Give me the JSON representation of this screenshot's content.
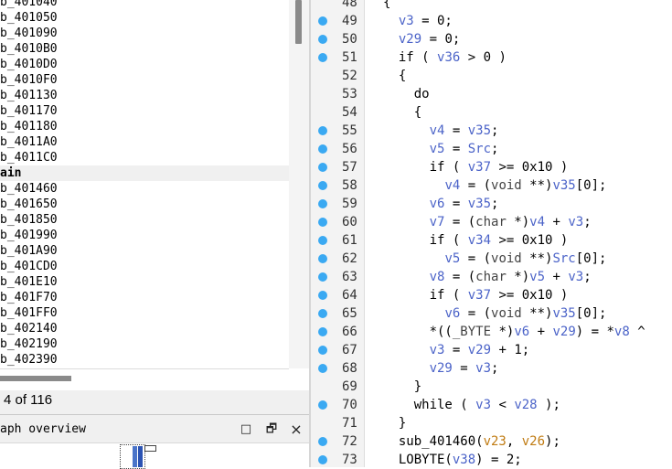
{
  "functions_panel": {
    "items": [
      {
        "label": "b_401040",
        "bold": false
      },
      {
        "label": "b_401050",
        "bold": false
      },
      {
        "label": "b_401090",
        "bold": false
      },
      {
        "label": "b_4010B0",
        "bold": false
      },
      {
        "label": "b_4010D0",
        "bold": false
      },
      {
        "label": "b_4010F0",
        "bold": false
      },
      {
        "label": "b_401130",
        "bold": false
      },
      {
        "label": "b_401170",
        "bold": false
      },
      {
        "label": "b_401180",
        "bold": false
      },
      {
        "label": "b_4011A0",
        "bold": false
      },
      {
        "label": "b_4011C0",
        "bold": false
      },
      {
        "label": "ain",
        "bold": true
      },
      {
        "label": "b_401460",
        "bold": false
      },
      {
        "label": "b_401650",
        "bold": false
      },
      {
        "label": "b_401850",
        "bold": false
      },
      {
        "label": "b_401990",
        "bold": false
      },
      {
        "label": "b_401A90",
        "bold": false
      },
      {
        "label": "b_401CD0",
        "bold": false
      },
      {
        "label": "b_401E10",
        "bold": false
      },
      {
        "label": "b_401F70",
        "bold": false
      },
      {
        "label": "b_401FF0",
        "bold": false
      },
      {
        "label": "b_402140",
        "bold": false
      },
      {
        "label": "b_402190",
        "bold": false
      },
      {
        "label": "b_402390",
        "bold": false
      }
    ],
    "count_text": "4 of 116"
  },
  "graph_overview": {
    "title": "aph overview",
    "maximize_icon": "□",
    "restore_icon": "🗗",
    "close_icon": "×"
  },
  "code_view": {
    "lines": [
      {
        "num": "48",
        "bp": false,
        "tokens": [
          {
            "t": "{",
            "c": "k"
          }
        ]
      },
      {
        "num": "49",
        "bp": true,
        "tokens": [
          {
            "t": "  ",
            "c": "k"
          },
          {
            "t": "v3",
            "c": "v"
          },
          {
            "t": " = 0;",
            "c": "k"
          }
        ]
      },
      {
        "num": "50",
        "bp": true,
        "tokens": [
          {
            "t": "  ",
            "c": "k"
          },
          {
            "t": "v29",
            "c": "v"
          },
          {
            "t": " = 0;",
            "c": "k"
          }
        ]
      },
      {
        "num": "51",
        "bp": true,
        "tokens": [
          {
            "t": "  if ( ",
            "c": "k"
          },
          {
            "t": "v36",
            "c": "v"
          },
          {
            "t": " > 0 )",
            "c": "k"
          }
        ]
      },
      {
        "num": "52",
        "bp": false,
        "tokens": [
          {
            "t": "  {",
            "c": "k"
          }
        ]
      },
      {
        "num": "53",
        "bp": false,
        "tokens": [
          {
            "t": "    do",
            "c": "k"
          }
        ]
      },
      {
        "num": "54",
        "bp": false,
        "tokens": [
          {
            "t": "    {",
            "c": "k"
          }
        ]
      },
      {
        "num": "55",
        "bp": true,
        "tokens": [
          {
            "t": "      ",
            "c": "k"
          },
          {
            "t": "v4",
            "c": "v"
          },
          {
            "t": " = ",
            "c": "k"
          },
          {
            "t": "v35",
            "c": "v"
          },
          {
            "t": ";",
            "c": "k"
          }
        ]
      },
      {
        "num": "56",
        "bp": true,
        "tokens": [
          {
            "t": "      ",
            "c": "k"
          },
          {
            "t": "v5",
            "c": "v"
          },
          {
            "t": " = ",
            "c": "k"
          },
          {
            "t": "Src",
            "c": "v"
          },
          {
            "t": ";",
            "c": "k"
          }
        ]
      },
      {
        "num": "57",
        "bp": true,
        "tokens": [
          {
            "t": "      if ( ",
            "c": "k"
          },
          {
            "t": "v37",
            "c": "v"
          },
          {
            "t": " >= 0x10 )",
            "c": "k"
          }
        ]
      },
      {
        "num": "58",
        "bp": true,
        "tokens": [
          {
            "t": "        ",
            "c": "k"
          },
          {
            "t": "v4",
            "c": "v"
          },
          {
            "t": " = (",
            "c": "k"
          },
          {
            "t": "void",
            "c": "g"
          },
          {
            "t": " **)",
            "c": "k"
          },
          {
            "t": "v35",
            "c": "v"
          },
          {
            "t": "[0];",
            "c": "k"
          }
        ]
      },
      {
        "num": "59",
        "bp": true,
        "tokens": [
          {
            "t": "      ",
            "c": "k"
          },
          {
            "t": "v6",
            "c": "v"
          },
          {
            "t": " = ",
            "c": "k"
          },
          {
            "t": "v35",
            "c": "v"
          },
          {
            "t": ";",
            "c": "k"
          }
        ]
      },
      {
        "num": "60",
        "bp": true,
        "tokens": [
          {
            "t": "      ",
            "c": "k"
          },
          {
            "t": "v7",
            "c": "v"
          },
          {
            "t": " = (",
            "c": "k"
          },
          {
            "t": "char",
            "c": "g"
          },
          {
            "t": " *)",
            "c": "k"
          },
          {
            "t": "v4",
            "c": "v"
          },
          {
            "t": " + ",
            "c": "k"
          },
          {
            "t": "v3",
            "c": "v"
          },
          {
            "t": ";",
            "c": "k"
          }
        ]
      },
      {
        "num": "61",
        "bp": true,
        "tokens": [
          {
            "t": "      if ( ",
            "c": "k"
          },
          {
            "t": "v34",
            "c": "v"
          },
          {
            "t": " >= 0x10 )",
            "c": "k"
          }
        ]
      },
      {
        "num": "62",
        "bp": true,
        "tokens": [
          {
            "t": "        ",
            "c": "k"
          },
          {
            "t": "v5",
            "c": "v"
          },
          {
            "t": " = (",
            "c": "k"
          },
          {
            "t": "void",
            "c": "g"
          },
          {
            "t": " **)",
            "c": "k"
          },
          {
            "t": "Src",
            "c": "v"
          },
          {
            "t": "[0];",
            "c": "k"
          }
        ]
      },
      {
        "num": "63",
        "bp": true,
        "tokens": [
          {
            "t": "      ",
            "c": "k"
          },
          {
            "t": "v8",
            "c": "v"
          },
          {
            "t": " = (",
            "c": "k"
          },
          {
            "t": "char",
            "c": "g"
          },
          {
            "t": " *)",
            "c": "k"
          },
          {
            "t": "v5",
            "c": "v"
          },
          {
            "t": " + ",
            "c": "k"
          },
          {
            "t": "v3",
            "c": "v"
          },
          {
            "t": ";",
            "c": "k"
          }
        ]
      },
      {
        "num": "64",
        "bp": true,
        "tokens": [
          {
            "t": "      if ( ",
            "c": "k"
          },
          {
            "t": "v37",
            "c": "v"
          },
          {
            "t": " >= 0x10 )",
            "c": "k"
          }
        ]
      },
      {
        "num": "65",
        "bp": true,
        "tokens": [
          {
            "t": "        ",
            "c": "k"
          },
          {
            "t": "v6",
            "c": "v"
          },
          {
            "t": " = (",
            "c": "k"
          },
          {
            "t": "void",
            "c": "g"
          },
          {
            "t": " **)",
            "c": "k"
          },
          {
            "t": "v35",
            "c": "v"
          },
          {
            "t": "[0];",
            "c": "k"
          }
        ]
      },
      {
        "num": "66",
        "bp": true,
        "tokens": [
          {
            "t": "      *((",
            "c": "k"
          },
          {
            "t": "_BYTE",
            "c": "g"
          },
          {
            "t": " *)",
            "c": "k"
          },
          {
            "t": "v6",
            "c": "v"
          },
          {
            "t": " + ",
            "c": "k"
          },
          {
            "t": "v29",
            "c": "v"
          },
          {
            "t": ") = *",
            "c": "k"
          },
          {
            "t": "v8",
            "c": "v"
          },
          {
            "t": " ^",
            "c": "k"
          }
        ]
      },
      {
        "num": "67",
        "bp": true,
        "tokens": [
          {
            "t": "      ",
            "c": "k"
          },
          {
            "t": "v3",
            "c": "v"
          },
          {
            "t": " = ",
            "c": "k"
          },
          {
            "t": "v29",
            "c": "v"
          },
          {
            "t": " + 1;",
            "c": "k"
          }
        ]
      },
      {
        "num": "68",
        "bp": true,
        "tokens": [
          {
            "t": "      ",
            "c": "k"
          },
          {
            "t": "v29",
            "c": "v"
          },
          {
            "t": " = ",
            "c": "k"
          },
          {
            "t": "v3",
            "c": "v"
          },
          {
            "t": ";",
            "c": "k"
          }
        ]
      },
      {
        "num": "69",
        "bp": false,
        "tokens": [
          {
            "t": "    }",
            "c": "k"
          }
        ]
      },
      {
        "num": "70",
        "bp": true,
        "tokens": [
          {
            "t": "    while ( ",
            "c": "k"
          },
          {
            "t": "v3",
            "c": "v"
          },
          {
            "t": " < ",
            "c": "k"
          },
          {
            "t": "v28",
            "c": "v"
          },
          {
            "t": " );",
            "c": "k"
          }
        ]
      },
      {
        "num": "71",
        "bp": false,
        "tokens": [
          {
            "t": "  }",
            "c": "k"
          }
        ]
      },
      {
        "num": "72",
        "bp": true,
        "tokens": [
          {
            "t": "  sub_401460(",
            "c": "k"
          },
          {
            "t": "v23",
            "c": "o"
          },
          {
            "t": ", ",
            "c": "k"
          },
          {
            "t": "v26",
            "c": "o"
          },
          {
            "t": ");",
            "c": "k"
          }
        ]
      },
      {
        "num": "73",
        "bp": true,
        "tokens": [
          {
            "t": "  LOBYTE(",
            "c": "k"
          },
          {
            "t": "v38",
            "c": "v"
          },
          {
            "t": ") = 2;",
            "c": "k"
          }
        ]
      }
    ]
  },
  "colors": {
    "variable": "#4b63c8",
    "argument": "#c07b12",
    "breakpoint": "#3aa9f2"
  }
}
